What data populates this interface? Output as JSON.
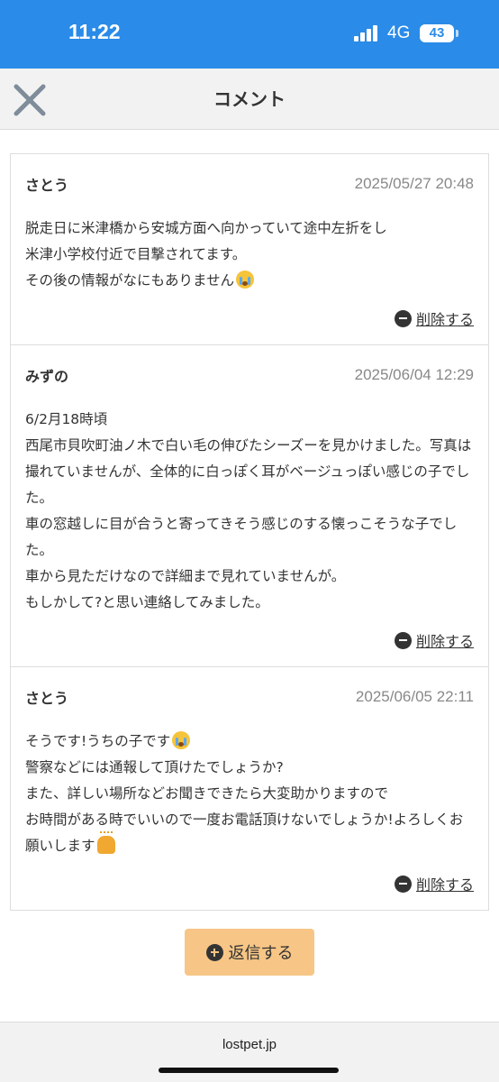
{
  "status_bar": {
    "time": "11:22",
    "network": "4G",
    "battery": "43",
    "icons": [
      "signal-icon",
      "battery-icon"
    ]
  },
  "header": {
    "title": "コメント",
    "close_icon": "close-icon"
  },
  "comments": [
    {
      "author": "さとう",
      "date": "2025/05/27 20:48",
      "body": "脱走日に米津橋から安城方面へ向かっていて途中左折をし\n米津小学校付近で目撃されてます。\nその後の情報がなにもありません",
      "trailing_emoji": "crying-face-icon",
      "delete_label": "削除する"
    },
    {
      "author": "みずの",
      "date": "2025/06/04 12:29",
      "body": "6/2月18時頃\n西尾市貝吹町油ノ木で白い毛の伸びたシーズーを見かけました。写真は撮れていませんが、全体的に白っぽく耳がベージュっぽい感じの子でした。\n車の窓越しに目が合うと寄ってきそう感じのする懐っこそうな子でした。\n車から見ただけなので詳細まで見れていませんが。\nもしかして?と思い連絡してみました。",
      "trailing_emoji": "",
      "delete_label": "削除する"
    },
    {
      "author": "さとう",
      "date": "2025/06/05 22:11",
      "body_line1": "そうです!うちの子です",
      "body_line1_emoji": "crying-face-icon",
      "body": "警察などには通報して頂けたでしょうか?\nまた、詳しい場所などお聞きできたら大変助かりますので\nお時間がある時でいいので一度お電話頂けないでしょうか!よろしくお願いします",
      "trailing_emoji": "bowing-person-icon",
      "delete_label": "削除する"
    }
  ],
  "reply_button": {
    "label": "返信する",
    "icon": "plus-circle-icon"
  },
  "browser": {
    "url": "lostpet.jp"
  },
  "colors": {
    "status_bar": "#2a8be8",
    "reply_button": "#f7c686",
    "header_bg": "#f2f2f2"
  }
}
